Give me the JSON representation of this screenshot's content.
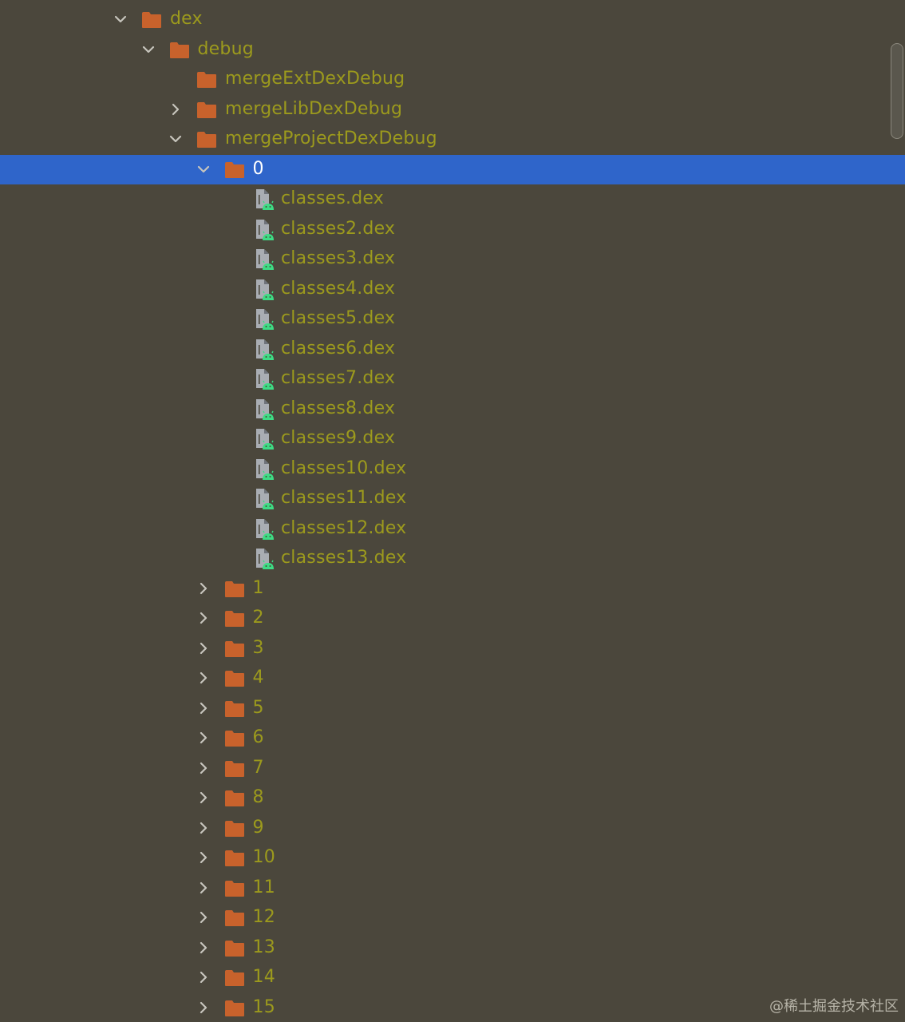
{
  "tree": {
    "nodes": [
      {
        "label": "dex",
        "kind": "folder",
        "depth": 0,
        "expanded": true
      },
      {
        "label": "debug",
        "kind": "folder",
        "depth": 1,
        "expanded": true
      },
      {
        "label": "mergeExtDexDebug",
        "kind": "folder",
        "depth": 2,
        "expandable": false
      },
      {
        "label": "mergeLibDexDebug",
        "kind": "folder",
        "depth": 2,
        "expanded": false
      },
      {
        "label": "mergeProjectDexDebug",
        "kind": "folder",
        "depth": 2,
        "expanded": true
      },
      {
        "label": "0",
        "kind": "folder",
        "depth": 3,
        "expanded": true,
        "selected": true
      },
      {
        "label": "classes.dex",
        "kind": "dex-file",
        "depth": 4
      },
      {
        "label": "classes2.dex",
        "kind": "dex-file",
        "depth": 4
      },
      {
        "label": "classes3.dex",
        "kind": "dex-file",
        "depth": 4
      },
      {
        "label": "classes4.dex",
        "kind": "dex-file",
        "depth": 4
      },
      {
        "label": "classes5.dex",
        "kind": "dex-file",
        "depth": 4
      },
      {
        "label": "classes6.dex",
        "kind": "dex-file",
        "depth": 4
      },
      {
        "label": "classes7.dex",
        "kind": "dex-file",
        "depth": 4
      },
      {
        "label": "classes8.dex",
        "kind": "dex-file",
        "depth": 4
      },
      {
        "label": "classes9.dex",
        "kind": "dex-file",
        "depth": 4
      },
      {
        "label": "classes10.dex",
        "kind": "dex-file",
        "depth": 4
      },
      {
        "label": "classes11.dex",
        "kind": "dex-file",
        "depth": 4
      },
      {
        "label": "classes12.dex",
        "kind": "dex-file",
        "depth": 4
      },
      {
        "label": "classes13.dex",
        "kind": "dex-file",
        "depth": 4
      },
      {
        "label": "1",
        "kind": "folder",
        "depth": 3,
        "expanded": false
      },
      {
        "label": "2",
        "kind": "folder",
        "depth": 3,
        "expanded": false
      },
      {
        "label": "3",
        "kind": "folder",
        "depth": 3,
        "expanded": false
      },
      {
        "label": "4",
        "kind": "folder",
        "depth": 3,
        "expanded": false
      },
      {
        "label": "5",
        "kind": "folder",
        "depth": 3,
        "expanded": false
      },
      {
        "label": "6",
        "kind": "folder",
        "depth": 3,
        "expanded": false
      },
      {
        "label": "7",
        "kind": "folder",
        "depth": 3,
        "expanded": false
      },
      {
        "label": "8",
        "kind": "folder",
        "depth": 3,
        "expanded": false
      },
      {
        "label": "9",
        "kind": "folder",
        "depth": 3,
        "expanded": false
      },
      {
        "label": "10",
        "kind": "folder",
        "depth": 3,
        "expanded": false
      },
      {
        "label": "11",
        "kind": "folder",
        "depth": 3,
        "expanded": false
      },
      {
        "label": "12",
        "kind": "folder",
        "depth": 3,
        "expanded": false
      },
      {
        "label": "13",
        "kind": "folder",
        "depth": 3,
        "expanded": false
      },
      {
        "label": "14",
        "kind": "folder",
        "depth": 3,
        "expanded": false
      },
      {
        "label": "15",
        "kind": "folder",
        "depth": 3,
        "expanded": false
      }
    ]
  },
  "colors": {
    "background": "#4b473c",
    "selection": "#2f65ca",
    "label_text": "#9c9a1d",
    "selected_text": "#ffffff",
    "folder": "#c8622c",
    "chevron": "#c7c5bd",
    "file_icon": "#a9adb3",
    "android_badge": "#3ddc84"
  },
  "icons": {
    "folder": "folder-icon",
    "file": "dex-file-icon",
    "expanded": "chevron-down-icon",
    "collapsed": "chevron-right-icon"
  },
  "watermark": {
    "text": "@稀土掘金技术社区"
  }
}
